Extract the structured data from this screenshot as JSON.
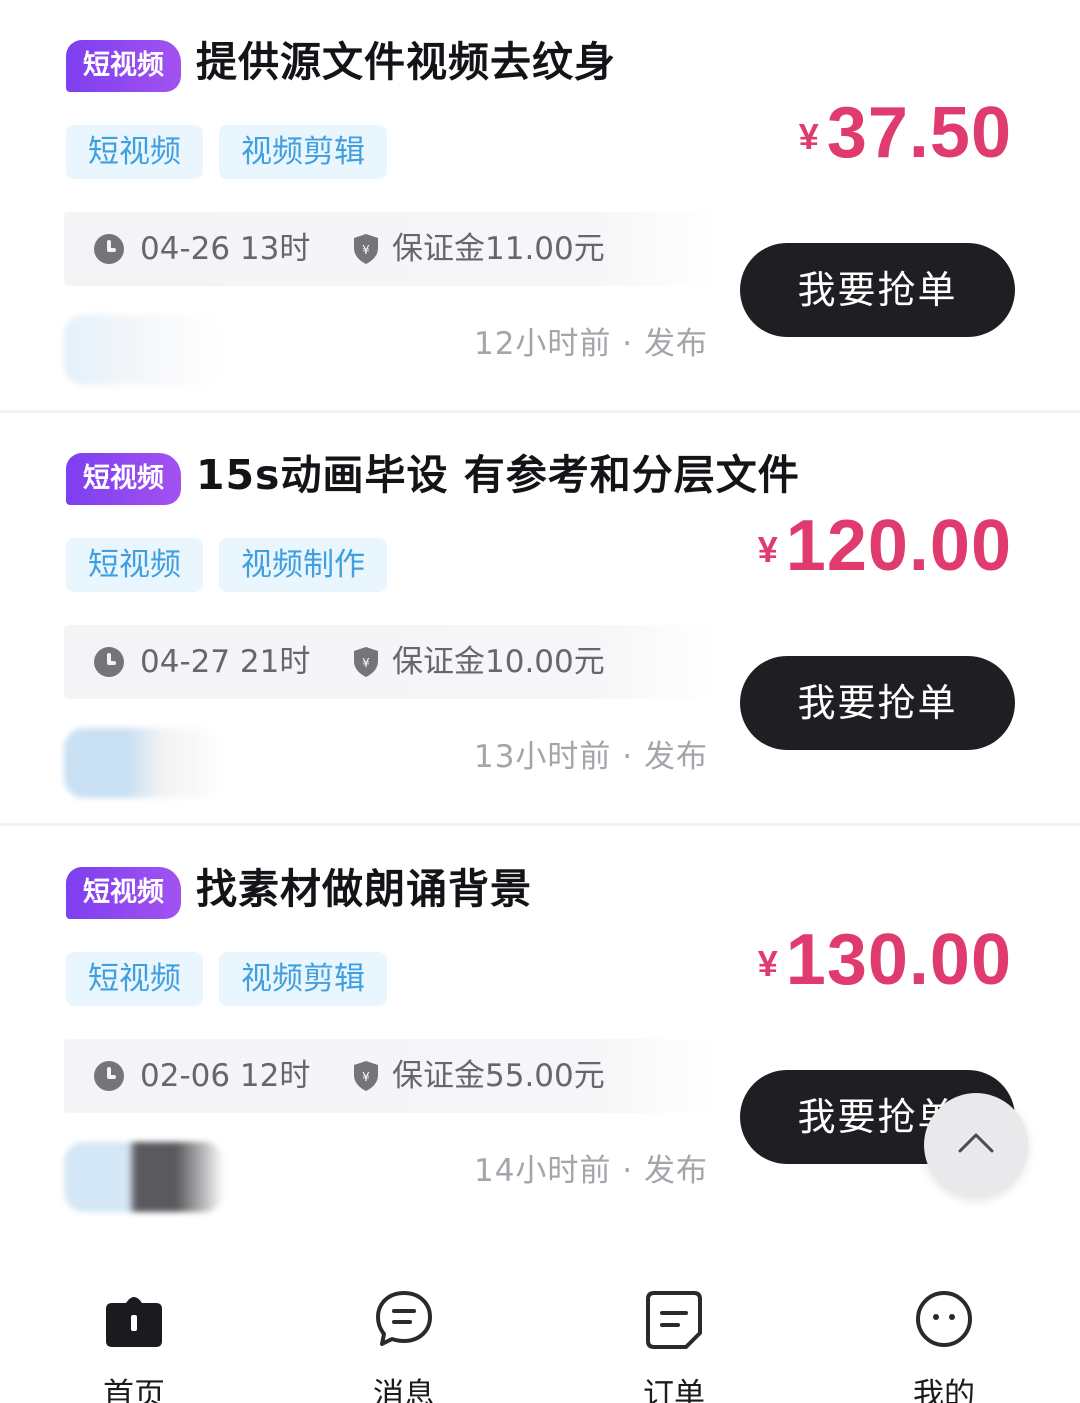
{
  "listings": [
    {
      "badge": "短视频",
      "title": "提供源文件视频去纹身",
      "tags": [
        "短视频",
        "视频剪辑"
      ],
      "currency": "¥",
      "price": "37.50",
      "time": "04-26 13时",
      "deposit": "保证金11.00元",
      "button": "我要抢单",
      "posted": "12小时前 · 发布"
    },
    {
      "badge": "短视频",
      "title": "15s动画毕设 有参考和分层文件",
      "tags": [
        "短视频",
        "视频制作"
      ],
      "currency": "¥",
      "price": "120.00",
      "time": "04-27 21时",
      "deposit": "保证金10.00元",
      "button": "我要抢单",
      "posted": "13小时前 · 发布"
    },
    {
      "badge": "短视频",
      "title": "找素材做朗诵背景",
      "tags": [
        "短视频",
        "视频剪辑"
      ],
      "currency": "¥",
      "price": "130.00",
      "time": "02-06 12时",
      "deposit": "保证金55.00元",
      "button": "我要抢单",
      "posted": "14小时前 · 发布"
    }
  ],
  "tabbar": {
    "items": [
      {
        "label": "首页",
        "icon": "home-icon"
      },
      {
        "label": "消息",
        "icon": "message-icon"
      },
      {
        "label": "订单",
        "icon": "order-icon"
      },
      {
        "label": "我的",
        "icon": "profile-icon"
      }
    ]
  },
  "colors": {
    "badge": "#8a45f0",
    "tag_bg": "#eaf6fd",
    "tag_text": "#3f9fe0",
    "price": "#e03b6f",
    "button": "#1f1f23"
  }
}
